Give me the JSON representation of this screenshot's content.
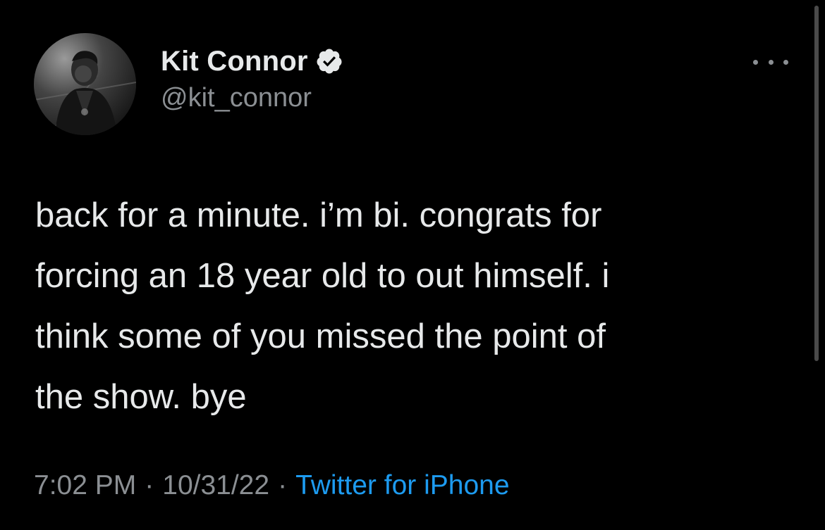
{
  "tweet": {
    "display_name": "Kit Connor",
    "handle": "@kit_connor",
    "verified": true,
    "text": "back for a minute. i’m bi. congrats for\nforcing an 18 year old to out himself. i\nthink some of you missed the point of\nthe show. bye",
    "time": "7:02 PM",
    "separator": "·",
    "date": "10/31/22",
    "source": "Twitter for iPhone"
  },
  "icons": {
    "verified": "verified-badge-icon",
    "more": "more-options-icon"
  },
  "colors": {
    "background": "#000000",
    "primary_text": "#e7e9ea",
    "secondary_text": "#8b8f93",
    "link": "#1d9bf0"
  }
}
